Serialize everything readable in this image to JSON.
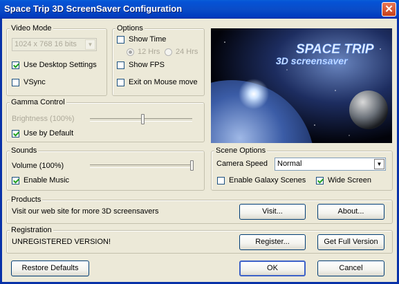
{
  "window": {
    "title": "Space Trip 3D ScreenSaver Configuration",
    "close": "✕"
  },
  "video_mode": {
    "label": "Video Mode",
    "resolution": "1024 x 768 16 bits",
    "use_desktop_settings": {
      "label": "Use Desktop Settings",
      "checked": true
    },
    "vsync": {
      "label": "VSync",
      "checked": false
    }
  },
  "options": {
    "label": "Options",
    "show_time": {
      "label": "Show Time",
      "checked": false
    },
    "time_12": {
      "label": "12 Hrs",
      "selected": true
    },
    "time_24": {
      "label": "24 Hrs",
      "selected": false
    },
    "show_fps": {
      "label": "Show FPS",
      "checked": false
    },
    "exit_on_mouse": {
      "label": "Exit on Mouse move",
      "checked": false
    }
  },
  "banner": {
    "line1": "SPACE TRIP",
    "line2": "3D screensaver"
  },
  "gamma": {
    "label": "Gamma Control",
    "brightness_label": "Brightness (100%)",
    "brightness_value": 0.6,
    "use_by_default": {
      "label": "Use by Default",
      "checked": true
    }
  },
  "sounds": {
    "label": "Sounds",
    "volume_label": "Volume (100%)",
    "volume_value": 1.0,
    "enable_music": {
      "label": "Enable Music",
      "checked": true
    }
  },
  "scene": {
    "label": "Scene Options",
    "camera_speed_label": "Camera Speed",
    "camera_speed_value": "Normal",
    "galaxy": {
      "label": "Enable Galaxy Scenes",
      "checked": false
    },
    "wide_screen": {
      "label": "Wide Screen",
      "checked": true
    }
  },
  "products": {
    "label": "Products",
    "text": "Visit our web site for more 3D screensavers",
    "visit": "Visit...",
    "about": "About..."
  },
  "registration": {
    "label": "Registration",
    "status": "UNREGISTERED VERSION!",
    "register": "Register...",
    "full": "Get Full Version"
  },
  "footer": {
    "restore": "Restore Defaults",
    "ok": "OK",
    "cancel": "Cancel"
  },
  "icons": {
    "dropdown": "chevron-down-icon",
    "check": "checkmark-icon",
    "close": "close-icon"
  }
}
